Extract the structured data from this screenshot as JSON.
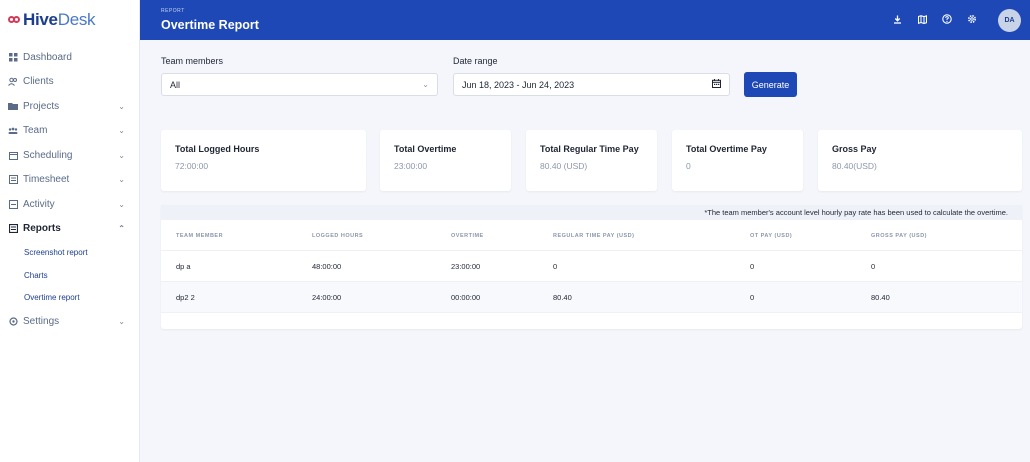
{
  "brand": {
    "part1": "Hive",
    "part2": "Desk"
  },
  "topbar": {
    "crumb": "REPORT",
    "title": "Overtime Report",
    "avatar": "DA",
    "icons": [
      "download-icon",
      "map-icon",
      "help-icon",
      "settings-icon"
    ]
  },
  "sidebar": {
    "items": [
      {
        "label": "Dashboard",
        "icon": "dashboard-icon"
      },
      {
        "label": "Clients",
        "icon": "clients-icon"
      },
      {
        "label": "Projects",
        "icon": "folder-icon",
        "chevron": "down"
      },
      {
        "label": "Team",
        "icon": "team-icon",
        "chevron": "down"
      },
      {
        "label": "Scheduling",
        "icon": "calendar-icon",
        "chevron": "down"
      },
      {
        "label": "Timesheet",
        "icon": "timesheet-icon",
        "chevron": "down"
      },
      {
        "label": "Activity",
        "icon": "activity-icon",
        "chevron": "down"
      },
      {
        "label": "Reports",
        "icon": "reports-icon",
        "chevron": "up",
        "active": true
      },
      {
        "label": "Settings",
        "icon": "settings-icon",
        "chevron": "down"
      }
    ],
    "sub_items": [
      "Screenshot report",
      "Charts",
      "Overtime report"
    ]
  },
  "filters": {
    "team_label": "Team members",
    "team_value": "All",
    "date_label": "Date range",
    "date_value": "Jun 18, 2023 - Jun 24, 2023",
    "generate": "Generate"
  },
  "cards": [
    {
      "title": "Total Logged Hours",
      "value": "72:00:00"
    },
    {
      "title": "Total Overtime",
      "value": "23:00:00"
    },
    {
      "title": "Total Regular Time Pay",
      "value": "80.40 (USD)"
    },
    {
      "title": "Total Overtime Pay",
      "value": "0"
    },
    {
      "title": "Gross Pay",
      "value": "80.40(USD)"
    }
  ],
  "table": {
    "note": "*The team member's account level hourly pay rate has been used to calculate the overtime.",
    "headers": [
      "TEAM MEMBER",
      "LOGGED HOURS",
      "OVERTIME",
      "REGULAR TIME PAY (USD)",
      "OT PAY (USD)",
      "GROSS PAY (USD)"
    ],
    "rows": [
      [
        "dp a",
        "48:00:00",
        "23:00:00",
        "0",
        "0",
        "0"
      ],
      [
        "dp2 2",
        "24:00:00",
        "00:00:00",
        "80.40",
        "0",
        "80.40"
      ]
    ]
  },
  "colors": {
    "primary": "#1d48b5",
    "brand_dark": "#1d3e8f",
    "brand_accent": "#d33a5a"
  }
}
